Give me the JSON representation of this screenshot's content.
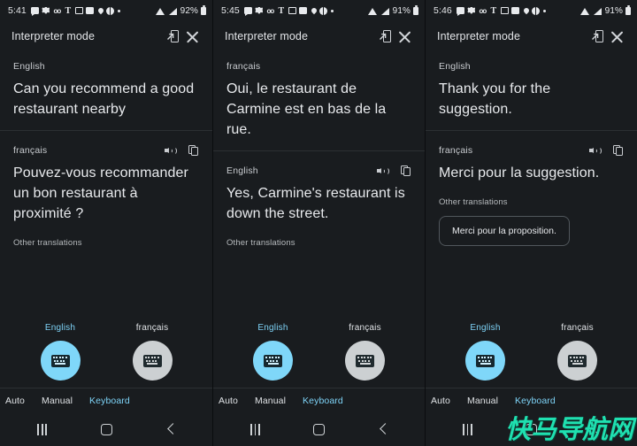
{
  "app": {
    "header_title": "Interpreter mode",
    "expand_icon": "open-in-phone-icon",
    "close_icon": "close-icon",
    "speaker_icon": "speaker-icon",
    "copy_icon": "copy-icon"
  },
  "colors": {
    "background": "#191c1f",
    "accent": "#7ed3f7",
    "mic_active": "#7fd7f9",
    "mic_idle": "#ccd0d2",
    "divider": "#2c3033",
    "text_primary": "#e8eaed",
    "text_secondary": "#c9ccd0",
    "watermark": "#1fe0b0"
  },
  "watermark": "快马导航网",
  "panels": [
    {
      "status": {
        "time": "5:41",
        "battery": "92%",
        "icons": [
          "chat-icon",
          "gear-icon",
          "voicemail-icon",
          "t-mobile-icon",
          "mms-icon",
          "screenshot-icon",
          "location-pin-icon",
          "globe-icon",
          "dot-icon"
        ],
        "right_icons": [
          "wifi-icon",
          "signal-icon",
          "battery-icon"
        ]
      },
      "blocks": [
        {
          "lang": "English",
          "text": "Can you recommend a good restaurant nearby",
          "has_actions": false,
          "other_label": null,
          "chip": null,
          "divider_after": true
        },
        {
          "lang": "français",
          "text": "Pouvez-vous recommander un bon restaurant à proximité ?",
          "has_actions": true,
          "other_label": "Other translations",
          "chip": null,
          "divider_after": false
        }
      ],
      "mics": [
        {
          "label": "English",
          "active": true
        },
        {
          "label": "français",
          "active": false
        }
      ],
      "modes": [
        {
          "label": "Auto",
          "selected": false
        },
        {
          "label": "Manual",
          "selected": false
        },
        {
          "label": "Keyboard",
          "selected": true
        }
      ],
      "nav": [
        "recent-apps-button",
        "home-button",
        "back-button"
      ]
    },
    {
      "status": {
        "time": "5:45",
        "battery": "91%",
        "icons": [
          "chat-icon",
          "gear-icon",
          "voicemail-icon",
          "t-mobile-icon",
          "mms-icon",
          "screenshot-icon",
          "location-pin-icon",
          "globe-icon",
          "dot-icon"
        ],
        "right_icons": [
          "wifi-icon",
          "signal-icon",
          "battery-icon"
        ]
      },
      "blocks": [
        {
          "lang": "français",
          "text": "Oui, le restaurant de Carmine est en bas de la rue.",
          "has_actions": false,
          "other_label": null,
          "chip": null,
          "divider_after": true
        },
        {
          "lang": "English",
          "text": "Yes, Carmine's restaurant is down the street.",
          "has_actions": true,
          "other_label": "Other translations",
          "chip": null,
          "divider_after": false
        }
      ],
      "mics": [
        {
          "label": "English",
          "active": true
        },
        {
          "label": "français",
          "active": false
        }
      ],
      "modes": [
        {
          "label": "Auto",
          "selected": false
        },
        {
          "label": "Manual",
          "selected": false
        },
        {
          "label": "Keyboard",
          "selected": true
        }
      ],
      "nav": [
        "recent-apps-button",
        "home-button",
        "back-button"
      ]
    },
    {
      "status": {
        "time": "5:46",
        "battery": "91%",
        "icons": [
          "chat-icon",
          "gear-icon",
          "voicemail-icon",
          "t-mobile-icon",
          "mms-icon",
          "screenshot-icon",
          "location-pin-icon",
          "globe-icon",
          "dot-icon"
        ],
        "right_icons": [
          "wifi-icon",
          "signal-icon",
          "battery-icon"
        ]
      },
      "blocks": [
        {
          "lang": "English",
          "text": "Thank you for the suggestion.",
          "has_actions": false,
          "other_label": null,
          "chip": null,
          "divider_after": true
        },
        {
          "lang": "français",
          "text": "Merci pour la suggestion.",
          "has_actions": true,
          "other_label": "Other translations",
          "chip": "Merci pour la proposition.",
          "divider_after": false
        }
      ],
      "mics": [
        {
          "label": "English",
          "active": true
        },
        {
          "label": "français",
          "active": false
        }
      ],
      "modes": [
        {
          "label": "Auto",
          "selected": false
        },
        {
          "label": "Manual",
          "selected": false
        },
        {
          "label": "Keyboard",
          "selected": true
        }
      ],
      "nav": [
        "recent-apps-button",
        "home-button",
        "back-button"
      ]
    }
  ]
}
